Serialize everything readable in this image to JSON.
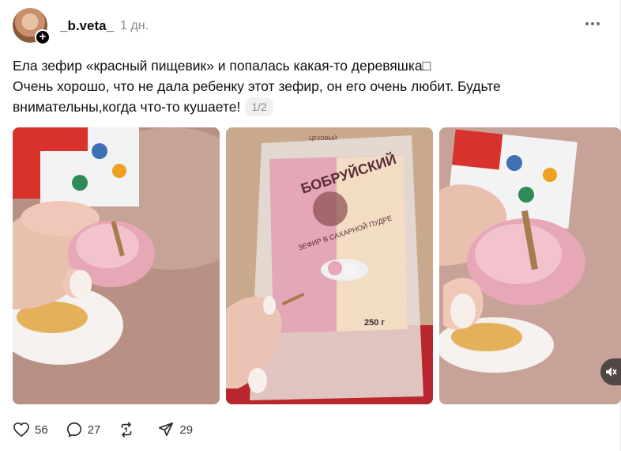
{
  "post": {
    "username": "_b.veta_",
    "time": "1 дн.",
    "text_line1": "Ела зефир «красный пищевик» и попалась какая-то деревяшка□",
    "text_line2": "Очень хорошо, что не дала ребенку этот зефир, он его очень любит. Будьте",
    "text_line3": "внимательны,когда что-то кушаете!",
    "media_counter": "1/2"
  },
  "package": {
    "brand_small": "ЦЕХОВЫЙ",
    "brand": "БОБРУЙСКИЙ",
    "product": "ЗЕФИР В САХАРНОЙ ПУДРЕ",
    "weight": "250 г"
  },
  "actions": {
    "likes": "56",
    "comments": "27",
    "reposts": "",
    "shares": "29"
  },
  "icons": {
    "avatar_plus": "+",
    "mute": "speaker-muted-icon"
  },
  "colors": {
    "marshmallow": "#e8a7b6",
    "box_red": "#d8322c"
  }
}
